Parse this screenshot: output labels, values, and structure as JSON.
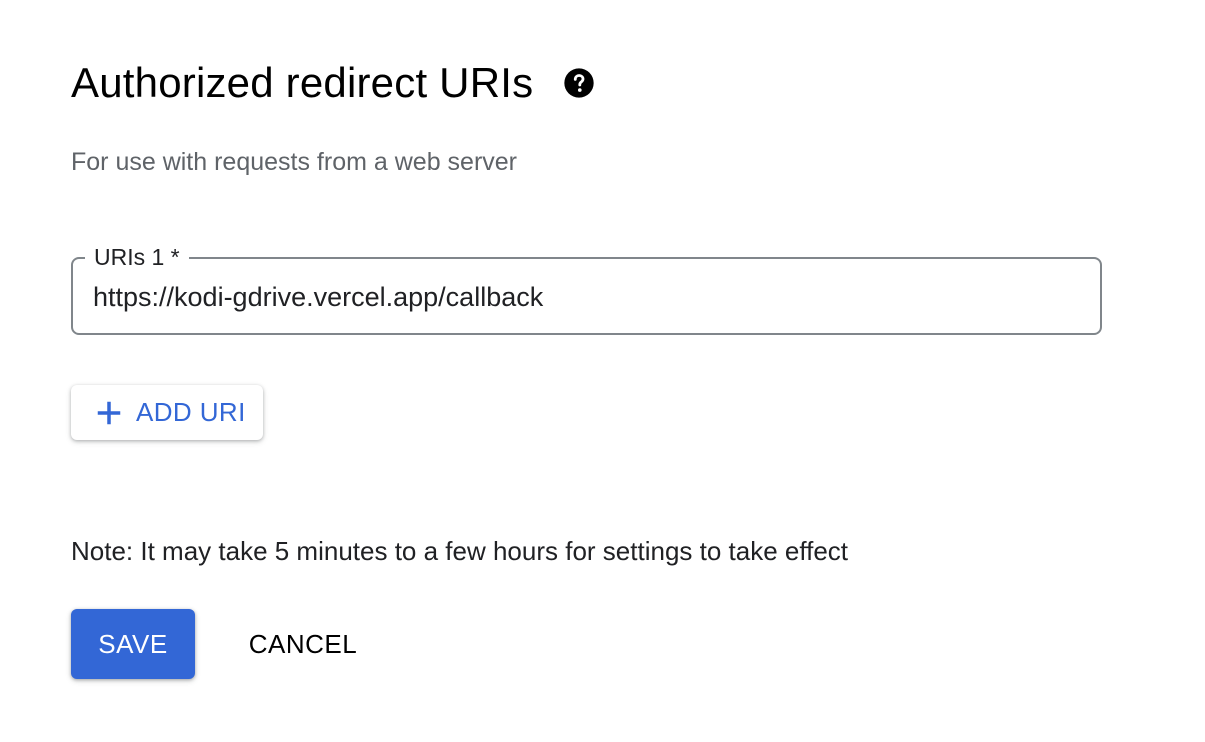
{
  "section": {
    "title": "Authorized redirect URIs",
    "help_icon": "help-circle-icon",
    "subtitle": "For use with requests from a web server"
  },
  "uri_field": {
    "label": "URIs 1 *",
    "value": "https://kodi-gdrive.vercel.app/callback"
  },
  "add_uri_button": {
    "icon": "plus-icon",
    "label": "ADD URI"
  },
  "note": "Note: It may take 5 minutes to a few hours for settings to take effect",
  "actions": {
    "save_label": "SAVE",
    "cancel_label": "CANCEL"
  },
  "colors": {
    "accent": "#3367d6",
    "field_border": "#80868b",
    "subtitle_text": "#5f6368",
    "body_text": "#202124"
  }
}
